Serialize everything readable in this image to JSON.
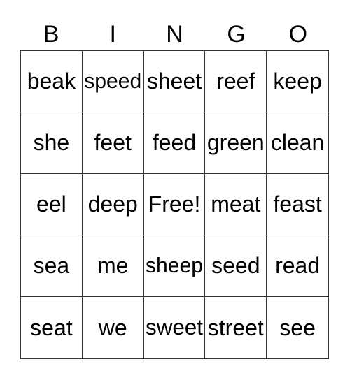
{
  "header": [
    "B",
    "I",
    "N",
    "G",
    "O"
  ],
  "cells": [
    [
      "beak",
      "speed",
      "sheet",
      "reef",
      "keep"
    ],
    [
      "she",
      "feet",
      "feed",
      "green",
      "clean"
    ],
    [
      "eel",
      "deep",
      "Free!",
      "meat",
      "feast"
    ],
    [
      "sea",
      "me",
      "sheep",
      "seed",
      "read"
    ],
    [
      "seat",
      "we",
      "sweet",
      "street",
      "see"
    ]
  ]
}
